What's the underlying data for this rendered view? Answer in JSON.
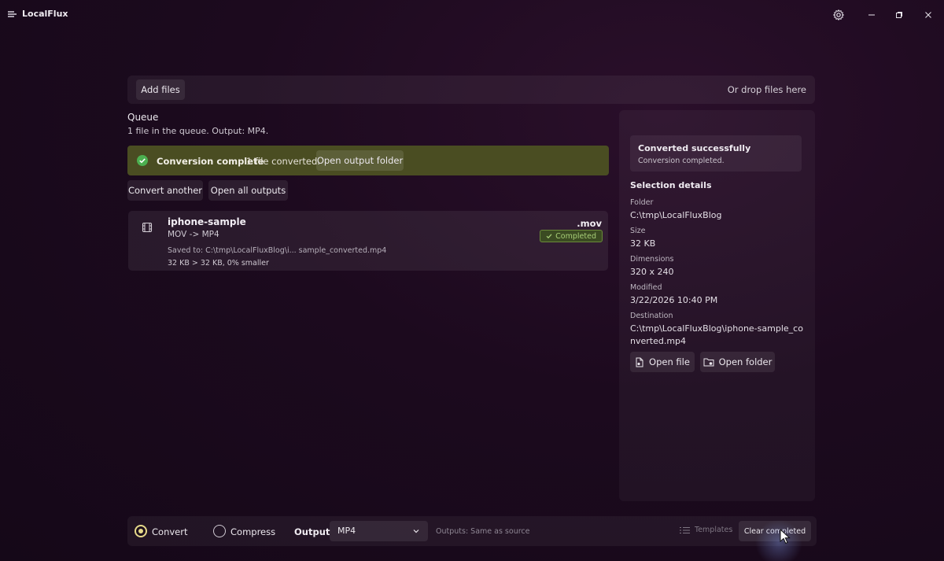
{
  "app": {
    "title": "LocalFlux"
  },
  "dropbar": {
    "add_files": "Add files",
    "drop_hint": "Or drop files here"
  },
  "queue": {
    "title": "Queue",
    "subtitle": "1 file in the queue. Output: MP4."
  },
  "banner": {
    "title": "Conversion complete",
    "message": "1 file converted.",
    "open_output": "Open output folder"
  },
  "actions": {
    "convert_another": "Convert another",
    "open_all": "Open all outputs"
  },
  "item": {
    "name": "iphone-sample",
    "conversion": "MOV -> MP4",
    "saved": "Saved to:  C:\\tmp\\LocalFluxBlog\\i...  sample_converted.mp4",
    "size": "32 KB   > 32 KB, 0% smaller",
    "ext": ".mov",
    "status": "Completed"
  },
  "panel": {
    "status_title": "Converted successfully",
    "status_msg": "Conversion completed.",
    "selection_title": "Selection details",
    "folder_label": "Folder",
    "folder_value": "C:\\tmp\\LocalFluxBlog",
    "size_label": "Size",
    "size_value": "32 KB",
    "dimensions_label": "Dimensions",
    "dimensions_value": "320 x 240",
    "modified_label": "Modified",
    "modified_value": "3/22/2026 10:40 PM",
    "destination_label": "Destination",
    "destination_value": "C:\\tmp\\LocalFluxBlog\\iphone-sample_converted.mp4",
    "open_file": "Open file",
    "open_folder": "Open folder"
  },
  "bottombar": {
    "convert": "Convert",
    "compress": "Compress",
    "output_label": "Output",
    "output_value": "MP4",
    "outputs_note": "Outputs: Same as source",
    "templates": "Templates",
    "clear_completed": "Clear completed",
    "mode_selected": "Convert"
  },
  "colors": {
    "banner_bg": "#4a4d22",
    "success_green": "#4caf50",
    "badge_text": "#a8cf78",
    "radio_accent": "#e6d98a"
  },
  "icons": {
    "logo": "localflux-logo-icon",
    "settings": "gear-icon",
    "minimize": "minimize-icon",
    "maximize": "maximize-icon",
    "close": "close-icon",
    "check": "check-circle-icon",
    "film": "film-icon",
    "open_file": "file-open-icon",
    "open_folder": "folder-open-icon",
    "chevron": "chevron-down-icon",
    "templates": "list-icon",
    "cursor": "mouse-cursor-icon"
  }
}
